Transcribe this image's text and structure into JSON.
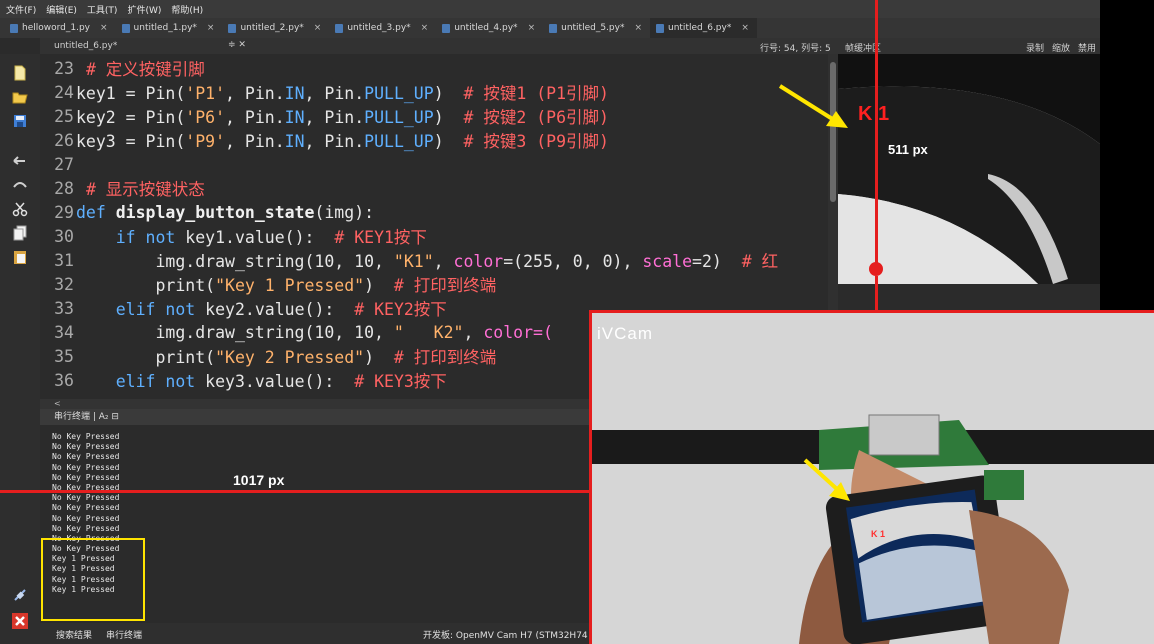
{
  "menu": [
    "文件(F)",
    "编辑(E)",
    "工具(T)",
    "扩件(W)",
    "帮助(H)"
  ],
  "tabs": [
    {
      "label": "helloword_1.py"
    },
    {
      "label": "untitled_1.py*"
    },
    {
      "label": "untitled_2.py*"
    },
    {
      "label": "untitled_3.py*"
    },
    {
      "label": "untitled_4.py*"
    },
    {
      "label": "untitled_5.py*"
    },
    {
      "label": "untitled_6.py*"
    }
  ],
  "tab_close": "×",
  "subbar": {
    "filename": "untitled_6.py*",
    "controls": "≑ ✕",
    "position": "行号: 54, 列号: 5",
    "framebuffer": "帧缓冲区",
    "record": "录制",
    "zoom": "缩放",
    "disable": "禁用"
  },
  "code_lines": [
    {
      "num": "23",
      "comment": "# 定义按键引脚"
    },
    {
      "num": "24",
      "var": "key1",
      "pin": "'P1'",
      "pull": "PULL_UP",
      "comment": "# 按键1 (P1引脚)"
    },
    {
      "num": "25",
      "var": "key2",
      "pin": "'P6'",
      "pull": "PULL_UP",
      "comment": "# 按键2 (P6引脚)"
    },
    {
      "num": "26",
      "var": "key3",
      "pin": "'P9'",
      "pull": "PULL_UP",
      "comment": "# 按键3 (P9引脚)"
    },
    {
      "num": "27"
    },
    {
      "num": "28",
      "comment": "# 显示按键状态"
    },
    {
      "num": "29",
      "fname": "display_button_state",
      "arg": "img"
    },
    {
      "num": "30",
      "key": "key1",
      "comment": "# KEY1按下"
    },
    {
      "num": "31",
      "x": "10",
      "y": "10",
      "text": "\"K1\"",
      "r": "255",
      "g": "0",
      "b": "0",
      "scale": "2",
      "comment": "# 红"
    },
    {
      "num": "32",
      "msg": "\"Key 1 Pressed\"",
      "comment": "# 打印到终端"
    },
    {
      "num": "33",
      "key": "key2",
      "comment": "# KEY2按下"
    },
    {
      "num": "34",
      "x": "10",
      "y": "10",
      "text": "\"   K2\"",
      "tail": "color=("
    },
    {
      "num": "35",
      "msg": "\"Key 2 Pressed\"",
      "comment": "# 打印到终端"
    },
    {
      "num": "36",
      "key": "key3",
      "comment": "# KEY3按下"
    }
  ],
  "hscroll": "<",
  "terminal_header": "串行终端  |  A₂ ⊟",
  "terminal_lines": [
    "No Key Pressed",
    "No Key Pressed",
    "No Key Pressed",
    "No Key Pressed",
    "No Key Pressed",
    "No Key Pressed",
    "No Key Pressed",
    "No Key Pressed",
    "No Key Pressed",
    "No Key Pressed",
    "No Key Pressed",
    "No Key Pressed",
    "Key 1 Pressed",
    "Key 1 Pressed",
    "Key 1 Pressed",
    "Key 1 Pressed"
  ],
  "status": {
    "tab1": "搜索结果",
    "tab2": "串行终端",
    "board": "开发板: OpenMV Cam H7 (STM32H74"
  },
  "framebuffer_label": "K 1",
  "annotations": {
    "fb_distance": "511 px",
    "term_distance": "1017 px",
    "cam_watermark": "iVCam",
    "screen_label": "K 1"
  },
  "colors": {
    "accent_red": "#e51e1e",
    "arrow_yellow": "#ffe600",
    "highlight_yellow": "#ffe400"
  },
  "icons": [
    "new-file-icon",
    "open-folder-icon",
    "save-icon",
    "undo-icon",
    "redo-icon",
    "cut-icon",
    "copy-icon",
    "paste-icon",
    "connect-icon",
    "stop-icon"
  ]
}
